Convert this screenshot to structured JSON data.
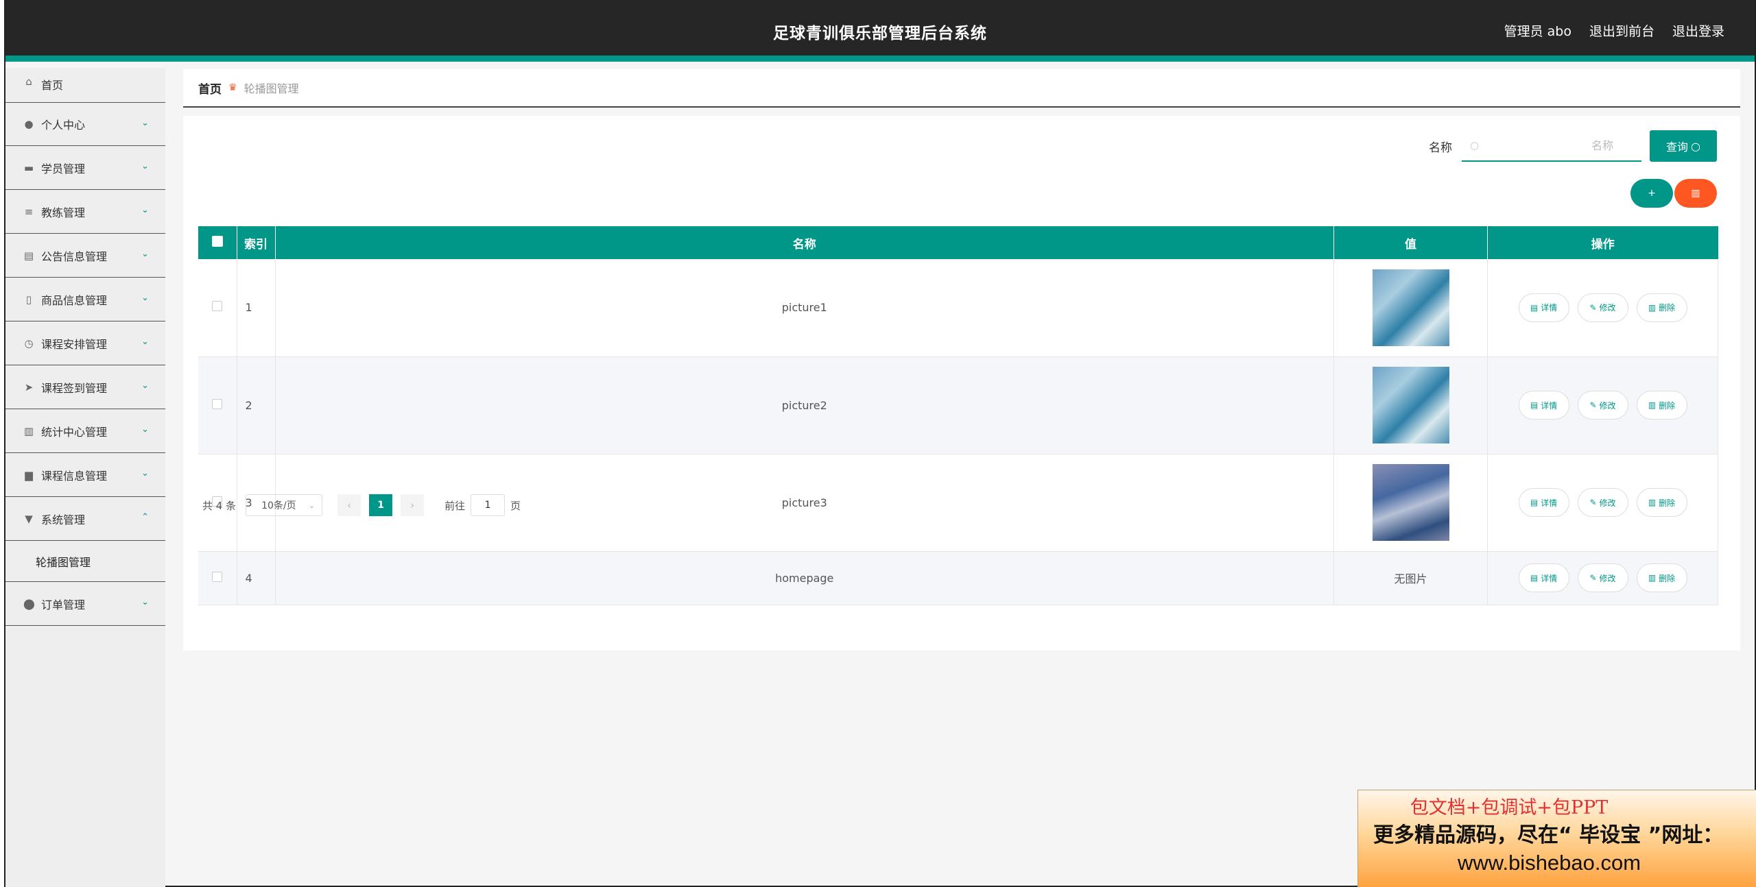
{
  "header": {
    "title": "足球青训俱乐部管理后台系统",
    "user_label": "管理员 abo",
    "to_front": "退出到前台",
    "logout": "退出登录"
  },
  "sidebar": {
    "items": [
      {
        "label": "首页",
        "icon": "home-icon"
      },
      {
        "label": "个人中心",
        "icon": "user-icon"
      },
      {
        "label": "学员管理",
        "icon": "ticket-icon"
      },
      {
        "label": "教练管理",
        "icon": "list-icon"
      },
      {
        "label": "公告信息管理",
        "icon": "clipboard-icon"
      },
      {
        "label": "商品信息管理",
        "icon": "mobile-icon"
      },
      {
        "label": "课程安排管理",
        "icon": "clock-icon"
      },
      {
        "label": "课程签到管理",
        "icon": "send-icon"
      },
      {
        "label": "统计中心管理",
        "icon": "bar-chart-icon"
      },
      {
        "label": "课程信息管理",
        "icon": "printer-icon"
      },
      {
        "label": "系统管理",
        "icon": "flag-icon"
      },
      {
        "label": "订单管理",
        "icon": "pin-icon"
      }
    ],
    "sub_item": "轮播图管理"
  },
  "breadcrumb": {
    "home": "首页",
    "current": "轮播图管理"
  },
  "search": {
    "label": "名称",
    "placeholder": "名称",
    "button": "查询"
  },
  "table": {
    "headers": {
      "index": "索引",
      "name": "名称",
      "value": "值",
      "ops": "操作"
    },
    "rows": [
      {
        "index": "1",
        "name": "picture1"
      },
      {
        "index": "2",
        "name": "picture2"
      },
      {
        "index": "3",
        "name": "picture3"
      },
      {
        "index": "4",
        "name": "homepage",
        "no_image": "无图片"
      }
    ],
    "ops": {
      "detail": "详情",
      "edit": "修改",
      "delete": "删除"
    }
  },
  "pager": {
    "total": "共 4 条",
    "size": "10条/页",
    "current": "1",
    "goto_prefix": "前往",
    "goto_value": "1",
    "goto_suffix": "页"
  },
  "ad": {
    "line1": "包文档+包调试+包PPT",
    "line2": "更多精品源码，尽在“ 毕设宝 ”网址：",
    "line3": "www.bishebao.com"
  },
  "colors": {
    "accent": "#009688",
    "danger": "#ff5722",
    "topbar": "#262626"
  }
}
